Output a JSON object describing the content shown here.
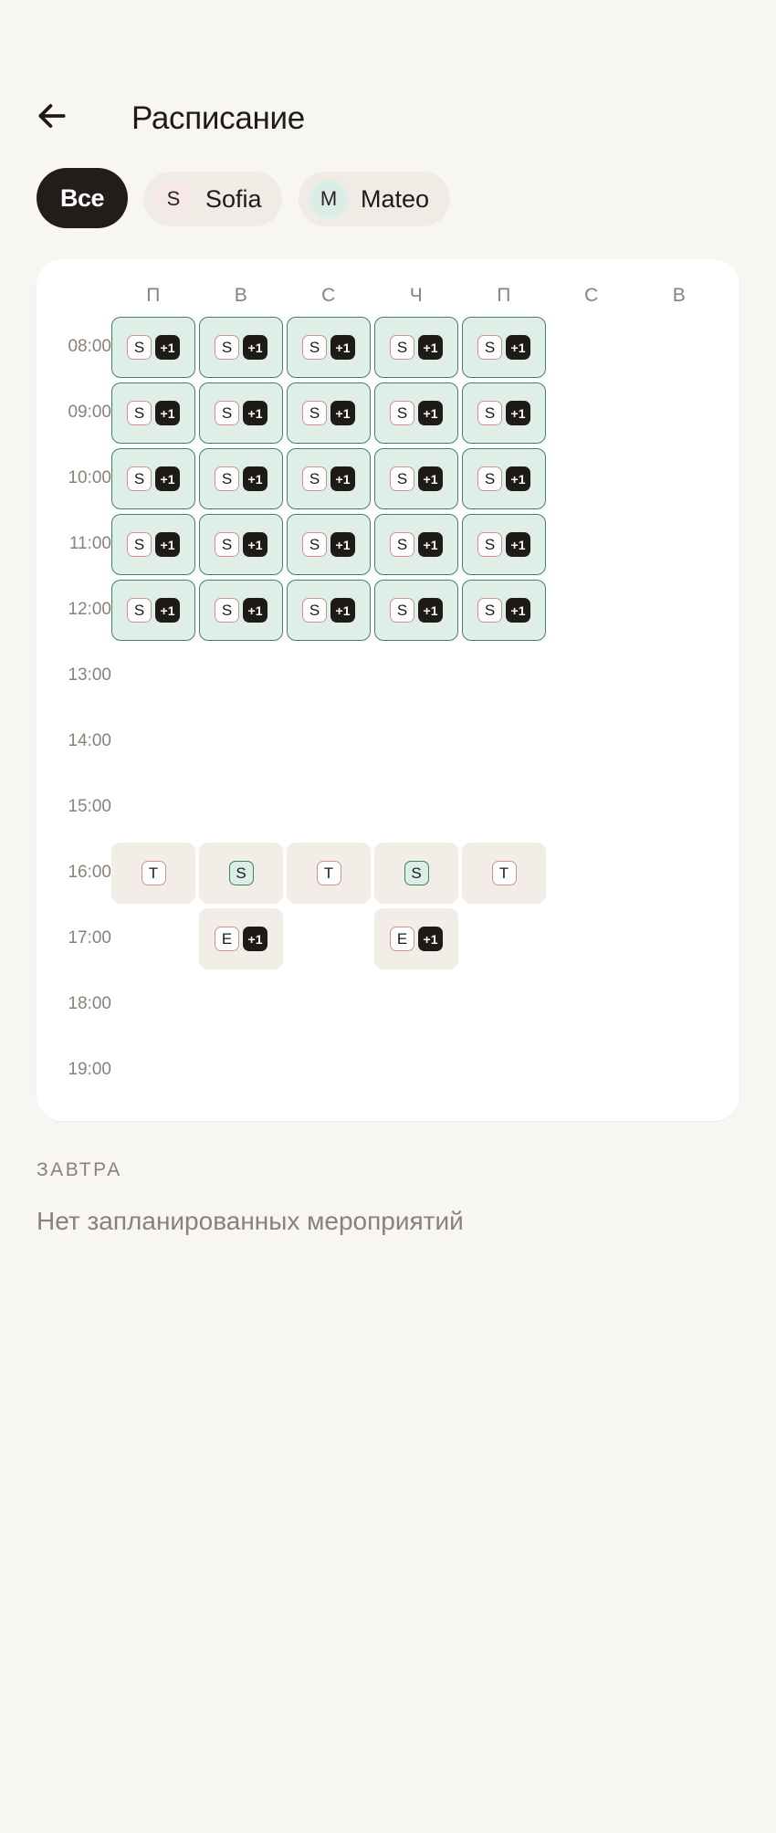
{
  "header": {
    "title": "Расписание"
  },
  "filters": {
    "all_label": "Все",
    "people": [
      {
        "initial": "S",
        "name": "Sofia"
      },
      {
        "initial": "M",
        "name": "Mateo"
      }
    ]
  },
  "schedule": {
    "days": [
      "П",
      "В",
      "С",
      "Ч",
      "П",
      "С",
      "В"
    ],
    "times": [
      "08:00",
      "09:00",
      "10:00",
      "11:00",
      "12:00",
      "13:00",
      "14:00",
      "15:00",
      "16:00",
      "17:00",
      "18:00",
      "19:00"
    ],
    "events": [
      {
        "day": 0,
        "time": 0,
        "style": "green",
        "badges": [
          {
            "text": "S",
            "color": "pink"
          },
          {
            "text": "+1",
            "color": "dark"
          }
        ]
      },
      {
        "day": 1,
        "time": 0,
        "style": "green",
        "badges": [
          {
            "text": "S",
            "color": "pink"
          },
          {
            "text": "+1",
            "color": "dark"
          }
        ]
      },
      {
        "day": 2,
        "time": 0,
        "style": "green",
        "badges": [
          {
            "text": "S",
            "color": "pink"
          },
          {
            "text": "+1",
            "color": "dark"
          }
        ]
      },
      {
        "day": 3,
        "time": 0,
        "style": "green",
        "badges": [
          {
            "text": "S",
            "color": "pink"
          },
          {
            "text": "+1",
            "color": "dark"
          }
        ]
      },
      {
        "day": 4,
        "time": 0,
        "style": "green",
        "badges": [
          {
            "text": "S",
            "color": "pink"
          },
          {
            "text": "+1",
            "color": "dark"
          }
        ]
      },
      {
        "day": 0,
        "time": 1,
        "style": "green",
        "badges": [
          {
            "text": "S",
            "color": "pink"
          },
          {
            "text": "+1",
            "color": "dark"
          }
        ]
      },
      {
        "day": 1,
        "time": 1,
        "style": "green",
        "badges": [
          {
            "text": "S",
            "color": "pink"
          },
          {
            "text": "+1",
            "color": "dark"
          }
        ]
      },
      {
        "day": 2,
        "time": 1,
        "style": "green",
        "badges": [
          {
            "text": "S",
            "color": "pink"
          },
          {
            "text": "+1",
            "color": "dark"
          }
        ]
      },
      {
        "day": 3,
        "time": 1,
        "style": "green",
        "badges": [
          {
            "text": "S",
            "color": "pink"
          },
          {
            "text": "+1",
            "color": "dark"
          }
        ]
      },
      {
        "day": 4,
        "time": 1,
        "style": "green",
        "badges": [
          {
            "text": "S",
            "color": "pink"
          },
          {
            "text": "+1",
            "color": "dark"
          }
        ]
      },
      {
        "day": 0,
        "time": 2,
        "style": "green",
        "badges": [
          {
            "text": "S",
            "color": "pink"
          },
          {
            "text": "+1",
            "color": "dark"
          }
        ]
      },
      {
        "day": 1,
        "time": 2,
        "style": "green",
        "badges": [
          {
            "text": "S",
            "color": "pink"
          },
          {
            "text": "+1",
            "color": "dark"
          }
        ]
      },
      {
        "day": 2,
        "time": 2,
        "style": "green",
        "badges": [
          {
            "text": "S",
            "color": "pink"
          },
          {
            "text": "+1",
            "color": "dark"
          }
        ]
      },
      {
        "day": 3,
        "time": 2,
        "style": "green",
        "badges": [
          {
            "text": "S",
            "color": "pink"
          },
          {
            "text": "+1",
            "color": "dark"
          }
        ]
      },
      {
        "day": 4,
        "time": 2,
        "style": "green",
        "badges": [
          {
            "text": "S",
            "color": "pink"
          },
          {
            "text": "+1",
            "color": "dark"
          }
        ]
      },
      {
        "day": 0,
        "time": 3,
        "style": "green",
        "badges": [
          {
            "text": "S",
            "color": "pink"
          },
          {
            "text": "+1",
            "color": "dark"
          }
        ]
      },
      {
        "day": 1,
        "time": 3,
        "style": "green",
        "badges": [
          {
            "text": "S",
            "color": "pink"
          },
          {
            "text": "+1",
            "color": "dark"
          }
        ]
      },
      {
        "day": 2,
        "time": 3,
        "style": "green",
        "badges": [
          {
            "text": "S",
            "color": "pink"
          },
          {
            "text": "+1",
            "color": "dark"
          }
        ]
      },
      {
        "day": 3,
        "time": 3,
        "style": "green",
        "badges": [
          {
            "text": "S",
            "color": "pink"
          },
          {
            "text": "+1",
            "color": "dark"
          }
        ]
      },
      {
        "day": 4,
        "time": 3,
        "style": "green",
        "badges": [
          {
            "text": "S",
            "color": "pink"
          },
          {
            "text": "+1",
            "color": "dark"
          }
        ]
      },
      {
        "day": 0,
        "time": 4,
        "style": "green",
        "badges": [
          {
            "text": "S",
            "color": "pink"
          },
          {
            "text": "+1",
            "color": "dark"
          }
        ]
      },
      {
        "day": 1,
        "time": 4,
        "style": "green",
        "badges": [
          {
            "text": "S",
            "color": "pink"
          },
          {
            "text": "+1",
            "color": "dark"
          }
        ]
      },
      {
        "day": 2,
        "time": 4,
        "style": "green",
        "badges": [
          {
            "text": "S",
            "color": "pink"
          },
          {
            "text": "+1",
            "color": "dark"
          }
        ]
      },
      {
        "day": 3,
        "time": 4,
        "style": "green",
        "badges": [
          {
            "text": "S",
            "color": "pink"
          },
          {
            "text": "+1",
            "color": "dark"
          }
        ]
      },
      {
        "day": 4,
        "time": 4,
        "style": "green",
        "badges": [
          {
            "text": "S",
            "color": "pink"
          },
          {
            "text": "+1",
            "color": "dark"
          }
        ]
      },
      {
        "day": 0,
        "time": 8,
        "style": "beige",
        "badges": [
          {
            "text": "T",
            "color": "pink"
          }
        ]
      },
      {
        "day": 1,
        "time": 8,
        "style": "beige",
        "badges": [
          {
            "text": "S",
            "color": "teal"
          }
        ]
      },
      {
        "day": 2,
        "time": 8,
        "style": "beige",
        "badges": [
          {
            "text": "T",
            "color": "pink"
          }
        ]
      },
      {
        "day": 3,
        "time": 8,
        "style": "beige",
        "badges": [
          {
            "text": "S",
            "color": "teal"
          }
        ]
      },
      {
        "day": 4,
        "time": 8,
        "style": "beige",
        "badges": [
          {
            "text": "T",
            "color": "pink"
          }
        ]
      },
      {
        "day": 1,
        "time": 9,
        "style": "beige",
        "badges": [
          {
            "text": "E",
            "color": "pink"
          },
          {
            "text": "+1",
            "color": "dark"
          }
        ]
      },
      {
        "day": 3,
        "time": 9,
        "style": "beige",
        "badges": [
          {
            "text": "E",
            "color": "pink"
          },
          {
            "text": "+1",
            "color": "dark"
          }
        ]
      }
    ]
  },
  "tomorrow": {
    "label": "ЗАВТРА",
    "empty_text": "Нет запланированных мероприятий"
  },
  "colors": {
    "background": "#f8f6f2",
    "accent_dark": "#221d1a",
    "event_green_bg": "#dfeee7",
    "event_green_border": "#3d8466",
    "event_beige_bg": "#f2ede6",
    "badge_pink": "#d88d96",
    "muted_text": "#8a8178"
  },
  "icons": {
    "back": "arrow-left-icon"
  }
}
